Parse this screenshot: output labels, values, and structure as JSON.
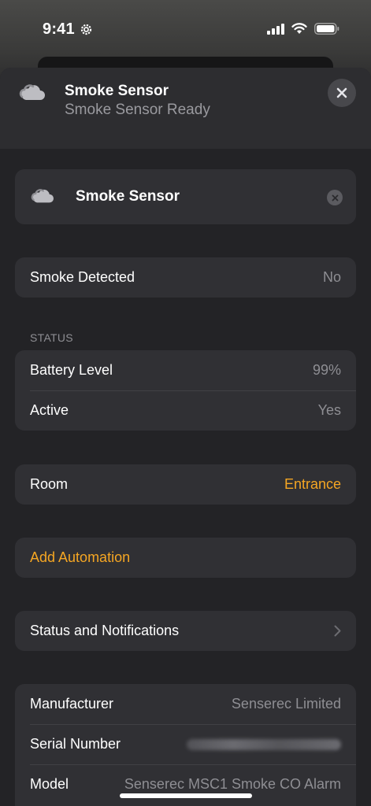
{
  "status_bar": {
    "time": "9:41"
  },
  "header": {
    "icon": "smoke-cloud-icon",
    "title": "Smoke Sensor",
    "subtitle": "Smoke Sensor Ready"
  },
  "name_field": {
    "value": "Smoke Sensor"
  },
  "smoke": {
    "label": "Smoke Detected",
    "value": "No"
  },
  "status_section": {
    "title": "STATUS",
    "rows": [
      {
        "label": "Battery Level",
        "value": "99%"
      },
      {
        "label": "Active",
        "value": "Yes"
      }
    ]
  },
  "room": {
    "label": "Room",
    "value": "Entrance"
  },
  "automation": {
    "label": "Add Automation"
  },
  "notifications": {
    "label": "Status and Notifications"
  },
  "info": {
    "manufacturer": {
      "label": "Manufacturer",
      "value": "Senserec Limited"
    },
    "serial": {
      "label": "Serial Number"
    },
    "model": {
      "label": "Model",
      "value": "Senserec MSC1 Smoke CO Alarm"
    }
  },
  "colors": {
    "accent": "#f5a623",
    "background": "#232326",
    "card": "#303034",
    "secondary_text": "#8e8e93"
  }
}
